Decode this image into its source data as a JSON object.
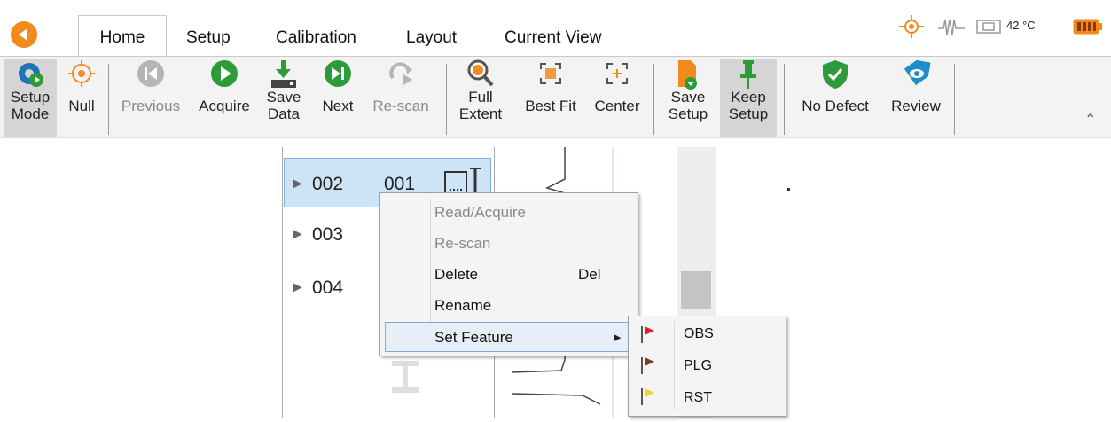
{
  "tabs": [
    {
      "label": "Home"
    },
    {
      "label": "Setup"
    },
    {
      "label": "Calibration"
    },
    {
      "label": "Layout"
    },
    {
      "label": "Current View"
    }
  ],
  "status": {
    "temperature": "42 °C"
  },
  "ribbon": {
    "setup_mode": "Setup\nMode",
    "null": "Null",
    "previous": "Previous",
    "acquire": "Acquire",
    "save_data": "Save\nData",
    "next": "Next",
    "rescan": "Re-scan",
    "full_extent": "Full\nExtent",
    "best_fit": "Best Fit",
    "center": "Center",
    "save_setup": "Save\nSetup",
    "keep_setup": "Keep\nSetup",
    "no_defect": "No Defect",
    "review": "Review"
  },
  "tree": {
    "items": [
      {
        "label": "002",
        "sub": "001"
      },
      {
        "label": "003"
      },
      {
        "label": "004"
      }
    ]
  },
  "context_menu": {
    "items": [
      {
        "label": "Read/Acquire",
        "disabled": true
      },
      {
        "label": "Re-scan",
        "disabled": true
      },
      {
        "label": "Delete",
        "shortcut": "Del"
      },
      {
        "label": "Rename"
      },
      {
        "label": "Set Feature"
      }
    ]
  },
  "submenu": {
    "items": [
      {
        "label": "OBS",
        "flag_color": "#e0202a"
      },
      {
        "label": "PLG",
        "flag_color": "#7a3a14"
      },
      {
        "label": "RST",
        "flag_color": "#f2d21a"
      }
    ]
  },
  "colors": {
    "orange": "#f28a1c",
    "green": "#2e9b3a",
    "teal": "#1d8fc8"
  }
}
